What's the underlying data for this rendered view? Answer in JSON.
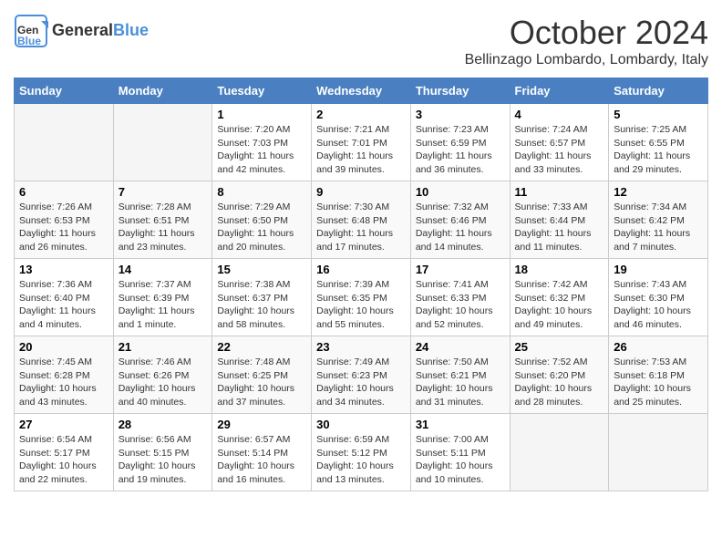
{
  "header": {
    "logo_general": "General",
    "logo_blue": "Blue",
    "month": "October 2024",
    "location": "Bellinzago Lombardo, Lombardy, Italy"
  },
  "days_of_week": [
    "Sunday",
    "Monday",
    "Tuesday",
    "Wednesday",
    "Thursday",
    "Friday",
    "Saturday"
  ],
  "weeks": [
    [
      {
        "day": "",
        "info": ""
      },
      {
        "day": "",
        "info": ""
      },
      {
        "day": "1",
        "info": "Sunrise: 7:20 AM\nSunset: 7:03 PM\nDaylight: 11 hours and 42 minutes."
      },
      {
        "day": "2",
        "info": "Sunrise: 7:21 AM\nSunset: 7:01 PM\nDaylight: 11 hours and 39 minutes."
      },
      {
        "day": "3",
        "info": "Sunrise: 7:23 AM\nSunset: 6:59 PM\nDaylight: 11 hours and 36 minutes."
      },
      {
        "day": "4",
        "info": "Sunrise: 7:24 AM\nSunset: 6:57 PM\nDaylight: 11 hours and 33 minutes."
      },
      {
        "day": "5",
        "info": "Sunrise: 7:25 AM\nSunset: 6:55 PM\nDaylight: 11 hours and 29 minutes."
      }
    ],
    [
      {
        "day": "6",
        "info": "Sunrise: 7:26 AM\nSunset: 6:53 PM\nDaylight: 11 hours and 26 minutes."
      },
      {
        "day": "7",
        "info": "Sunrise: 7:28 AM\nSunset: 6:51 PM\nDaylight: 11 hours and 23 minutes."
      },
      {
        "day": "8",
        "info": "Sunrise: 7:29 AM\nSunset: 6:50 PM\nDaylight: 11 hours and 20 minutes."
      },
      {
        "day": "9",
        "info": "Sunrise: 7:30 AM\nSunset: 6:48 PM\nDaylight: 11 hours and 17 minutes."
      },
      {
        "day": "10",
        "info": "Sunrise: 7:32 AM\nSunset: 6:46 PM\nDaylight: 11 hours and 14 minutes."
      },
      {
        "day": "11",
        "info": "Sunrise: 7:33 AM\nSunset: 6:44 PM\nDaylight: 11 hours and 11 minutes."
      },
      {
        "day": "12",
        "info": "Sunrise: 7:34 AM\nSunset: 6:42 PM\nDaylight: 11 hours and 7 minutes."
      }
    ],
    [
      {
        "day": "13",
        "info": "Sunrise: 7:36 AM\nSunset: 6:40 PM\nDaylight: 11 hours and 4 minutes."
      },
      {
        "day": "14",
        "info": "Sunrise: 7:37 AM\nSunset: 6:39 PM\nDaylight: 11 hours and 1 minute."
      },
      {
        "day": "15",
        "info": "Sunrise: 7:38 AM\nSunset: 6:37 PM\nDaylight: 10 hours and 58 minutes."
      },
      {
        "day": "16",
        "info": "Sunrise: 7:39 AM\nSunset: 6:35 PM\nDaylight: 10 hours and 55 minutes."
      },
      {
        "day": "17",
        "info": "Sunrise: 7:41 AM\nSunset: 6:33 PM\nDaylight: 10 hours and 52 minutes."
      },
      {
        "day": "18",
        "info": "Sunrise: 7:42 AM\nSunset: 6:32 PM\nDaylight: 10 hours and 49 minutes."
      },
      {
        "day": "19",
        "info": "Sunrise: 7:43 AM\nSunset: 6:30 PM\nDaylight: 10 hours and 46 minutes."
      }
    ],
    [
      {
        "day": "20",
        "info": "Sunrise: 7:45 AM\nSunset: 6:28 PM\nDaylight: 10 hours and 43 minutes."
      },
      {
        "day": "21",
        "info": "Sunrise: 7:46 AM\nSunset: 6:26 PM\nDaylight: 10 hours and 40 minutes."
      },
      {
        "day": "22",
        "info": "Sunrise: 7:48 AM\nSunset: 6:25 PM\nDaylight: 10 hours and 37 minutes."
      },
      {
        "day": "23",
        "info": "Sunrise: 7:49 AM\nSunset: 6:23 PM\nDaylight: 10 hours and 34 minutes."
      },
      {
        "day": "24",
        "info": "Sunrise: 7:50 AM\nSunset: 6:21 PM\nDaylight: 10 hours and 31 minutes."
      },
      {
        "day": "25",
        "info": "Sunrise: 7:52 AM\nSunset: 6:20 PM\nDaylight: 10 hours and 28 minutes."
      },
      {
        "day": "26",
        "info": "Sunrise: 7:53 AM\nSunset: 6:18 PM\nDaylight: 10 hours and 25 minutes."
      }
    ],
    [
      {
        "day": "27",
        "info": "Sunrise: 6:54 AM\nSunset: 5:17 PM\nDaylight: 10 hours and 22 minutes."
      },
      {
        "day": "28",
        "info": "Sunrise: 6:56 AM\nSunset: 5:15 PM\nDaylight: 10 hours and 19 minutes."
      },
      {
        "day": "29",
        "info": "Sunrise: 6:57 AM\nSunset: 5:14 PM\nDaylight: 10 hours and 16 minutes."
      },
      {
        "day": "30",
        "info": "Sunrise: 6:59 AM\nSunset: 5:12 PM\nDaylight: 10 hours and 13 minutes."
      },
      {
        "day": "31",
        "info": "Sunrise: 7:00 AM\nSunset: 5:11 PM\nDaylight: 10 hours and 10 minutes."
      },
      {
        "day": "",
        "info": ""
      },
      {
        "day": "",
        "info": ""
      }
    ]
  ]
}
